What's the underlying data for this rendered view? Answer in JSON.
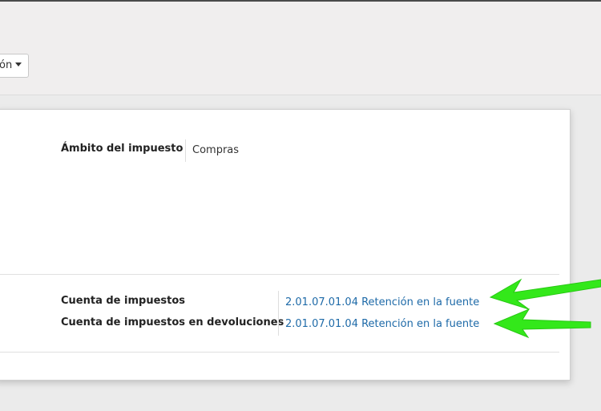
{
  "control_panel": {
    "dropdown_label": "ón"
  },
  "form": {
    "tax_scope": {
      "label": "Ámbito del impuesto",
      "value": "Compras"
    },
    "tax_account": {
      "label": "Cuenta de impuestos",
      "value": "2.01.07.01.04 Retención en la fuente"
    },
    "refund_tax_account": {
      "label": "Cuenta de impuestos en devoluciones",
      "value": "2.01.07.01.04 Retención en la fuente"
    }
  },
  "annotations": {
    "arrow_color": "#33e81a"
  },
  "colors": {
    "link": "#1e6aa8",
    "panel_bg": "#f0eeee",
    "sheet_bg": "#ffffff"
  }
}
